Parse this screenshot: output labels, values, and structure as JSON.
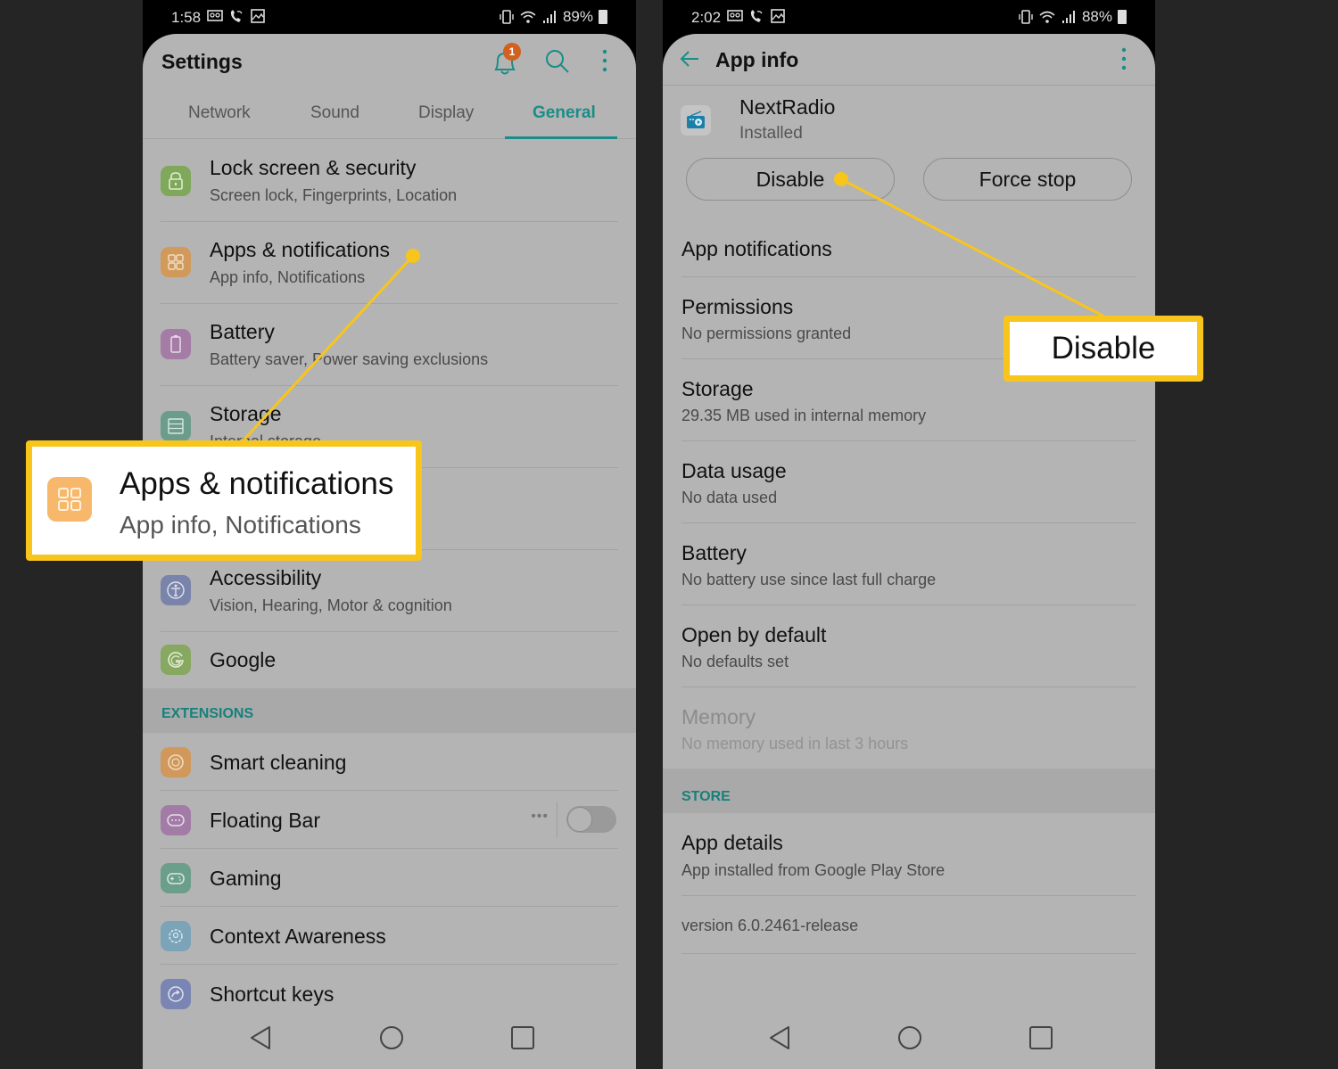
{
  "left_phone": {
    "status": {
      "time": "1:58",
      "battery": "89%"
    },
    "title": "Settings",
    "notification_count": "1",
    "tabs": [
      {
        "label": "Network",
        "active": false
      },
      {
        "label": "Sound",
        "active": false
      },
      {
        "label": "Display",
        "active": false
      },
      {
        "label": "General",
        "active": true
      }
    ],
    "items": [
      {
        "title": "Lock screen & security",
        "subtitle": "Screen lock, Fingerprints, Location",
        "icon": "lock-icon",
        "color": "#7fa85a"
      },
      {
        "title": "Apps & notifications",
        "subtitle": "App info, Notifications",
        "icon": "apps-grid-icon",
        "color": "#d19a5a"
      },
      {
        "title": "Battery",
        "subtitle": "Battery saver, Power saving exclusions",
        "icon": "battery-icon",
        "color": "#a47ca6"
      },
      {
        "title": "Storage",
        "subtitle": "Internal storage",
        "icon": "storage-icon",
        "color": "#6c9c8c"
      },
      {
        "title": "Accessibility",
        "subtitle": "Vision, Hearing, Motor & cognition",
        "icon": "accessibility-icon",
        "color": "#7a84aa"
      },
      {
        "title": "Google",
        "subtitle": "",
        "icon": "google-icon",
        "color": "#86a860"
      }
    ],
    "section_extensions": "EXTENSIONS",
    "extensions": [
      {
        "title": "Smart cleaning",
        "icon": "smart-cleaning-icon",
        "color": "#d0985a"
      },
      {
        "title": "Floating Bar",
        "icon": "floating-bar-icon",
        "color": "#a27ca7",
        "toggle_on": false
      },
      {
        "title": "Gaming",
        "icon": "gaming-icon",
        "color": "#6c9f8a"
      },
      {
        "title": "Context Awareness",
        "icon": "context-awareness-icon",
        "color": "#7ba4b8"
      },
      {
        "title": "Shortcut keys",
        "icon": "shortcut-keys-icon",
        "color": "#7b85b3"
      }
    ]
  },
  "right_phone": {
    "status": {
      "time": "2:02",
      "battery": "88%"
    },
    "title": "App info",
    "app": {
      "name": "NextRadio",
      "status": "Installed"
    },
    "buttons": {
      "disable": "Disable",
      "force_stop": "Force stop"
    },
    "items": [
      {
        "title": "App notifications",
        "subtitle": ""
      },
      {
        "title": "Permissions",
        "subtitle": "No permissions granted"
      },
      {
        "title": "Storage",
        "subtitle": "29.35 MB used in internal memory"
      },
      {
        "title": "Data usage",
        "subtitle": "No data used"
      },
      {
        "title": "Battery",
        "subtitle": "No battery use since last full charge"
      },
      {
        "title": "Open by default",
        "subtitle": "No defaults set"
      },
      {
        "title": "Memory",
        "subtitle": "No memory used in last 3 hours",
        "disabled": true
      }
    ],
    "section_store": "STORE",
    "store_items": [
      {
        "title": "App details",
        "subtitle": "App installed from Google Play Store"
      }
    ],
    "version": "version 6.0.2461-release"
  },
  "callouts": {
    "apps": {
      "title": "Apps & notifications",
      "subtitle": "App info, Notifications"
    },
    "disable": {
      "label": "Disable"
    }
  },
  "colors": {
    "accent": "#1a8d88",
    "callout": "#f8c51c",
    "badge": "#d0611e"
  }
}
